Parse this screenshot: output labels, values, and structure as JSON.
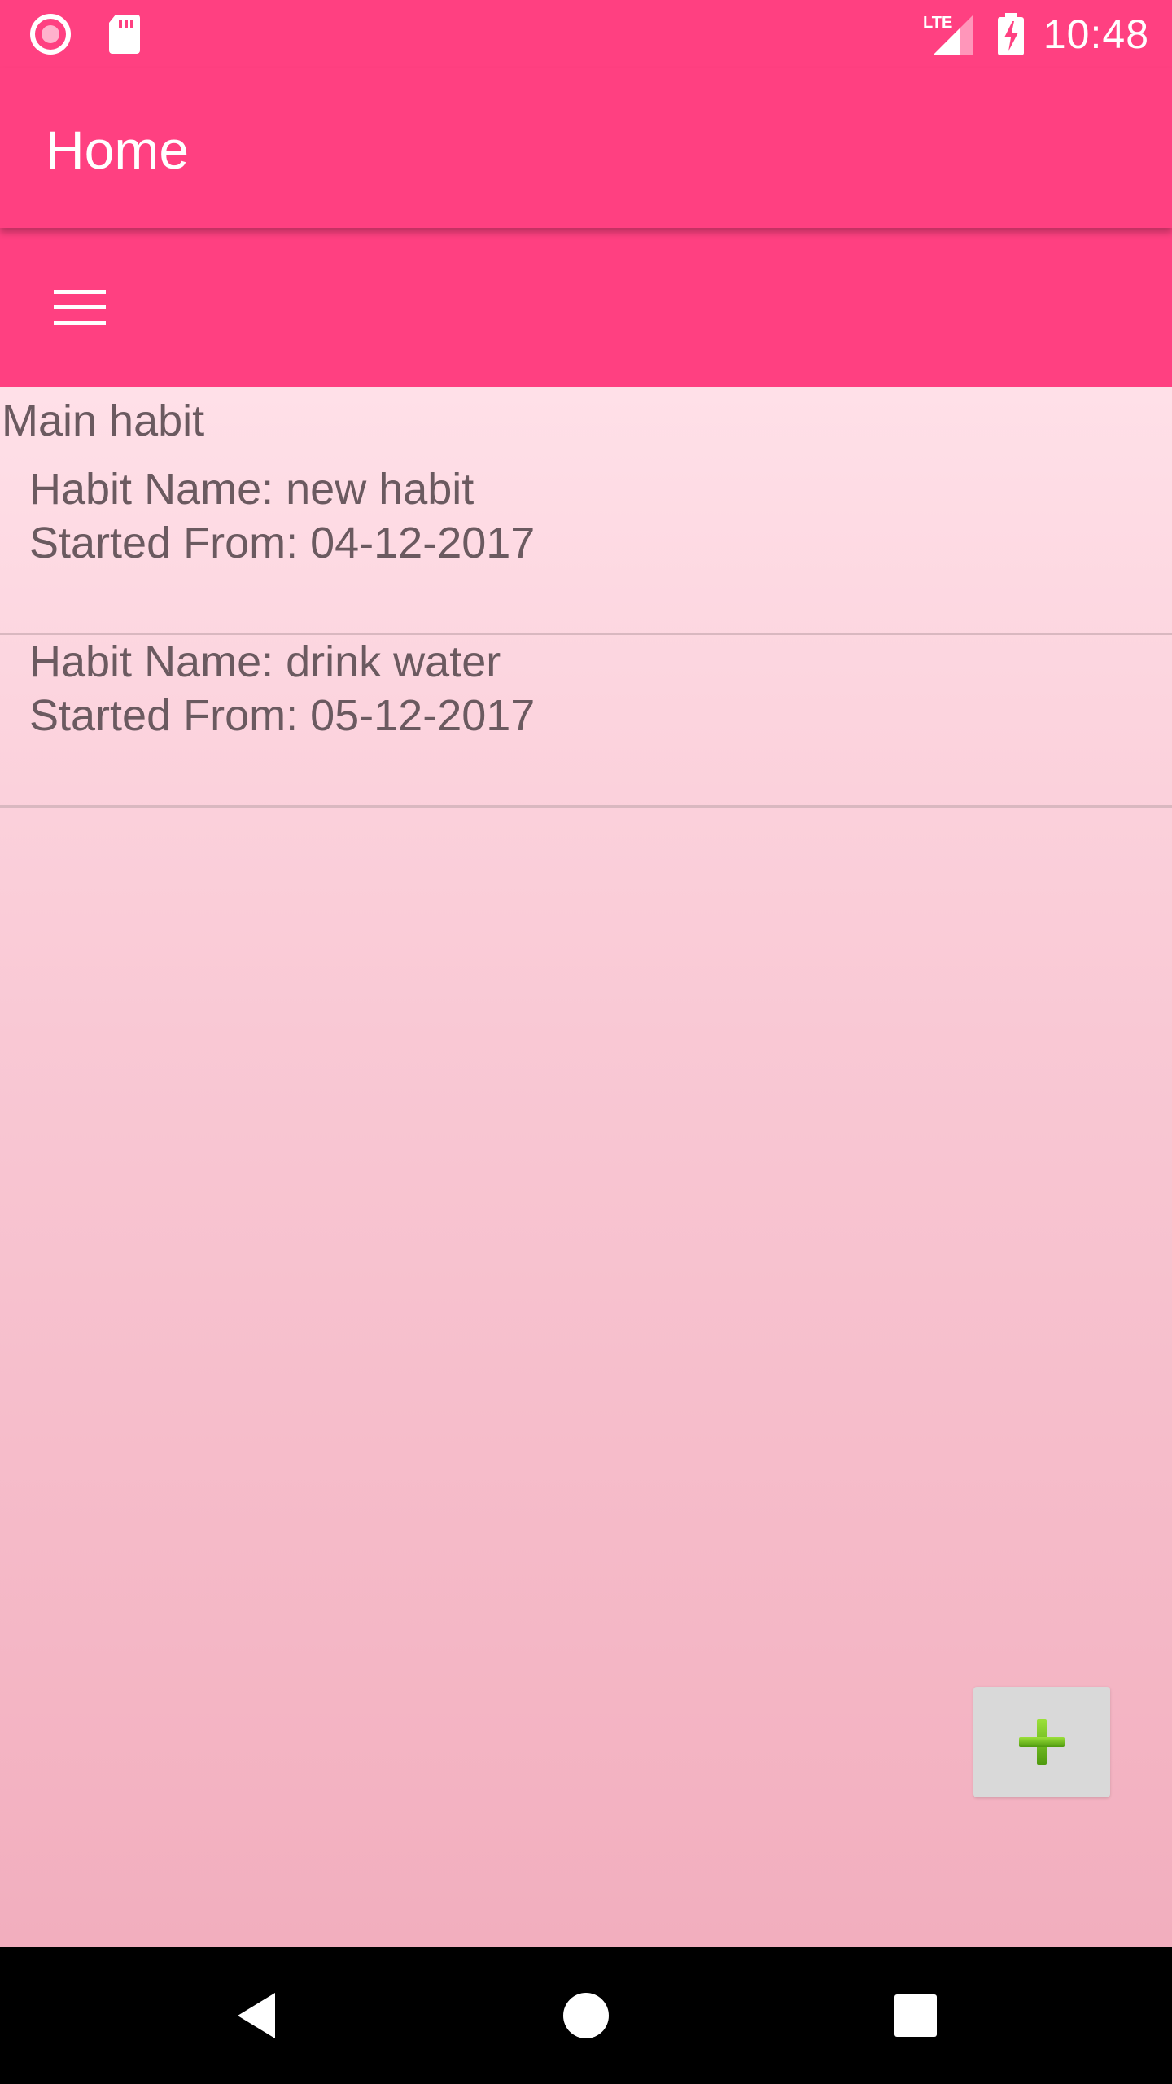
{
  "status_bar": {
    "time": "10:48",
    "network_label": "LTE",
    "icons": [
      "record-icon",
      "sd-card-icon",
      "signal-icon",
      "battery-charging-icon"
    ]
  },
  "app_bar": {
    "title": "Home"
  },
  "toolbar": {
    "menu_icon": "hamburger-menu-icon"
  },
  "main": {
    "section_title": "Main habit",
    "habits": [
      {
        "name_label": "Habit Name: ",
        "name": "new habit",
        "date_label": "Started From: ",
        "date": "04-12-2017"
      },
      {
        "name_label": "Habit Name: ",
        "name": "drink water",
        "date_label": "Started From: ",
        "date": "05-12-2017"
      }
    ]
  },
  "fab": {
    "icon": "plus-icon"
  },
  "nav_bar": {
    "buttons": [
      "back-icon",
      "home-icon",
      "recents-icon"
    ]
  },
  "colors": {
    "primary": "#FF4081",
    "text": "#6b5a60",
    "plus": "#6FBF1A",
    "fab_bg": "#d9d9d9"
  }
}
